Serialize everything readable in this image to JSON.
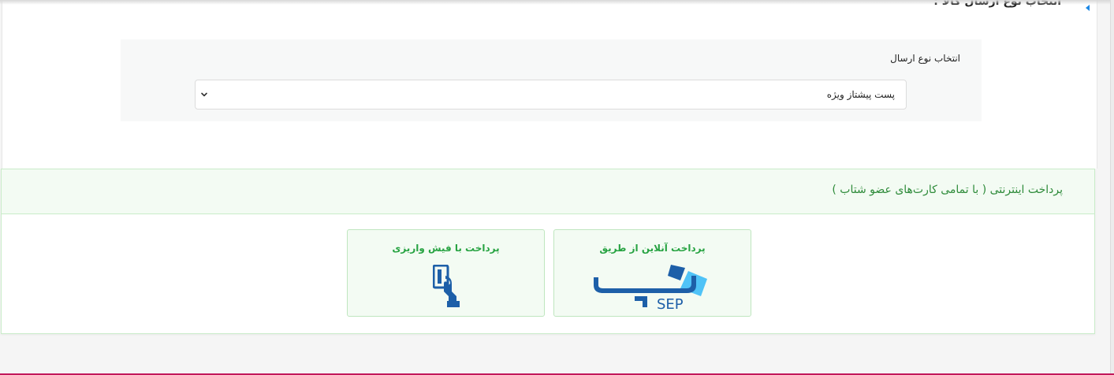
{
  "shipping": {
    "section_title": "انتخاب نوع ارسال کالا :",
    "label": "انتخاب نوع ارسال",
    "selected_value": "پست پیشتاز ویژه"
  },
  "payment": {
    "header": "پرداخت اینترنتی ( با تمامی کارت‌های عضو شتاب )",
    "options": [
      {
        "title": "پرداخت آنلاین از طریق",
        "logo_text": "SEP",
        "icon": "sep-logo-icon"
      },
      {
        "title": "پرداخت با فیش واریزی",
        "icon": "hand-card-icon"
      }
    ]
  },
  "colors": {
    "accent_green": "#27a342",
    "header_green": "#2e8b3a",
    "sep_blue": "#1d5fa8",
    "sep_light_blue": "#4fc3f7",
    "marker_blue": "#1e88e5",
    "bottom_bar": "#c2185b"
  }
}
